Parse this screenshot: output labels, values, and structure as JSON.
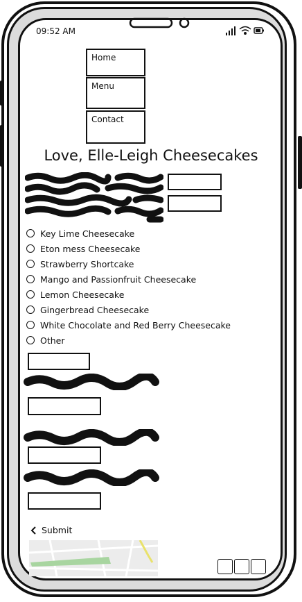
{
  "status_bar": {
    "time": "09:52 AM",
    "icons": [
      "signal-icon",
      "wifi-icon",
      "battery-icon"
    ]
  },
  "nav": {
    "items": [
      {
        "label": "Home"
      },
      {
        "label": "Menu"
      },
      {
        "label": "Contact"
      }
    ]
  },
  "page": {
    "title": "Love, Elle-Leigh Cheesecakes"
  },
  "flavors": {
    "options": [
      {
        "label": "Key Lime Cheesecake"
      },
      {
        "label": "Eton mess Cheesecake"
      },
      {
        "label": "Strawberry Shortcake"
      },
      {
        "label": "Mango and Passionfruit Cheesecake"
      },
      {
        "label": "Lemon Cheesecake"
      },
      {
        "label": "Gingerbread Cheesecake"
      },
      {
        "label": "White Chocolate and Red Berry Cheesecake"
      },
      {
        "label": "Other"
      }
    ]
  },
  "form": {
    "submit_label": "Submit"
  },
  "colors": {
    "ink": "#111111",
    "frame_gray": "#dcdcdc",
    "map_green": "#a8d5a0",
    "map_road": "#e9e26b"
  }
}
